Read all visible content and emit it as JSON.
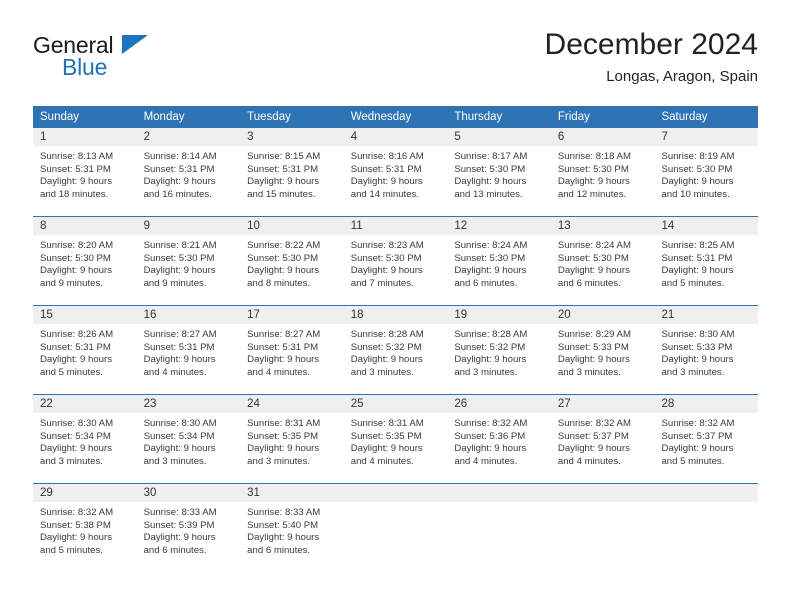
{
  "brand": {
    "name_top": "General",
    "name_bottom": "Blue"
  },
  "header": {
    "month_title": "December 2024",
    "location": "Longas, Aragon, Spain"
  },
  "colors": {
    "header_blue": "#2e74b5",
    "logo_blue": "#1e73be",
    "daynum_band": "#efefef",
    "row_divider": "#2e74b5",
    "page_background": "#ffffff"
  },
  "calendar": {
    "day_headers": [
      "Sunday",
      "Monday",
      "Tuesday",
      "Wednesday",
      "Thursday",
      "Friday",
      "Saturday"
    ],
    "weeks": [
      [
        {
          "day": "1",
          "sunrise": "Sunrise: 8:13 AM",
          "sunset": "Sunset: 5:31 PM",
          "daylight_line1": "Daylight: 9 hours",
          "daylight_line2": "and 18 minutes."
        },
        {
          "day": "2",
          "sunrise": "Sunrise: 8:14 AM",
          "sunset": "Sunset: 5:31 PM",
          "daylight_line1": "Daylight: 9 hours",
          "daylight_line2": "and 16 minutes."
        },
        {
          "day": "3",
          "sunrise": "Sunrise: 8:15 AM",
          "sunset": "Sunset: 5:31 PM",
          "daylight_line1": "Daylight: 9 hours",
          "daylight_line2": "and 15 minutes."
        },
        {
          "day": "4",
          "sunrise": "Sunrise: 8:16 AM",
          "sunset": "Sunset: 5:31 PM",
          "daylight_line1": "Daylight: 9 hours",
          "daylight_line2": "and 14 minutes."
        },
        {
          "day": "5",
          "sunrise": "Sunrise: 8:17 AM",
          "sunset": "Sunset: 5:30 PM",
          "daylight_line1": "Daylight: 9 hours",
          "daylight_line2": "and 13 minutes."
        },
        {
          "day": "6",
          "sunrise": "Sunrise: 8:18 AM",
          "sunset": "Sunset: 5:30 PM",
          "daylight_line1": "Daylight: 9 hours",
          "daylight_line2": "and 12 minutes."
        },
        {
          "day": "7",
          "sunrise": "Sunrise: 8:19 AM",
          "sunset": "Sunset: 5:30 PM",
          "daylight_line1": "Daylight: 9 hours",
          "daylight_line2": "and 10 minutes."
        }
      ],
      [
        {
          "day": "8",
          "sunrise": "Sunrise: 8:20 AM",
          "sunset": "Sunset: 5:30 PM",
          "daylight_line1": "Daylight: 9 hours",
          "daylight_line2": "and 9 minutes."
        },
        {
          "day": "9",
          "sunrise": "Sunrise: 8:21 AM",
          "sunset": "Sunset: 5:30 PM",
          "daylight_line1": "Daylight: 9 hours",
          "daylight_line2": "and 9 minutes."
        },
        {
          "day": "10",
          "sunrise": "Sunrise: 8:22 AM",
          "sunset": "Sunset: 5:30 PM",
          "daylight_line1": "Daylight: 9 hours",
          "daylight_line2": "and 8 minutes."
        },
        {
          "day": "11",
          "sunrise": "Sunrise: 8:23 AM",
          "sunset": "Sunset: 5:30 PM",
          "daylight_line1": "Daylight: 9 hours",
          "daylight_line2": "and 7 minutes."
        },
        {
          "day": "12",
          "sunrise": "Sunrise: 8:24 AM",
          "sunset": "Sunset: 5:30 PM",
          "daylight_line1": "Daylight: 9 hours",
          "daylight_line2": "and 6 minutes."
        },
        {
          "day": "13",
          "sunrise": "Sunrise: 8:24 AM",
          "sunset": "Sunset: 5:30 PM",
          "daylight_line1": "Daylight: 9 hours",
          "daylight_line2": "and 6 minutes."
        },
        {
          "day": "14",
          "sunrise": "Sunrise: 8:25 AM",
          "sunset": "Sunset: 5:31 PM",
          "daylight_line1": "Daylight: 9 hours",
          "daylight_line2": "and 5 minutes."
        }
      ],
      [
        {
          "day": "15",
          "sunrise": "Sunrise: 8:26 AM",
          "sunset": "Sunset: 5:31 PM",
          "daylight_line1": "Daylight: 9 hours",
          "daylight_line2": "and 5 minutes."
        },
        {
          "day": "16",
          "sunrise": "Sunrise: 8:27 AM",
          "sunset": "Sunset: 5:31 PM",
          "daylight_line1": "Daylight: 9 hours",
          "daylight_line2": "and 4 minutes."
        },
        {
          "day": "17",
          "sunrise": "Sunrise: 8:27 AM",
          "sunset": "Sunset: 5:31 PM",
          "daylight_line1": "Daylight: 9 hours",
          "daylight_line2": "and 4 minutes."
        },
        {
          "day": "18",
          "sunrise": "Sunrise: 8:28 AM",
          "sunset": "Sunset: 5:32 PM",
          "daylight_line1": "Daylight: 9 hours",
          "daylight_line2": "and 3 minutes."
        },
        {
          "day": "19",
          "sunrise": "Sunrise: 8:28 AM",
          "sunset": "Sunset: 5:32 PM",
          "daylight_line1": "Daylight: 9 hours",
          "daylight_line2": "and 3 minutes."
        },
        {
          "day": "20",
          "sunrise": "Sunrise: 8:29 AM",
          "sunset": "Sunset: 5:33 PM",
          "daylight_line1": "Daylight: 9 hours",
          "daylight_line2": "and 3 minutes."
        },
        {
          "day": "21",
          "sunrise": "Sunrise: 8:30 AM",
          "sunset": "Sunset: 5:33 PM",
          "daylight_line1": "Daylight: 9 hours",
          "daylight_line2": "and 3 minutes."
        }
      ],
      [
        {
          "day": "22",
          "sunrise": "Sunrise: 8:30 AM",
          "sunset": "Sunset: 5:34 PM",
          "daylight_line1": "Daylight: 9 hours",
          "daylight_line2": "and 3 minutes."
        },
        {
          "day": "23",
          "sunrise": "Sunrise: 8:30 AM",
          "sunset": "Sunset: 5:34 PM",
          "daylight_line1": "Daylight: 9 hours",
          "daylight_line2": "and 3 minutes."
        },
        {
          "day": "24",
          "sunrise": "Sunrise: 8:31 AM",
          "sunset": "Sunset: 5:35 PM",
          "daylight_line1": "Daylight: 9 hours",
          "daylight_line2": "and 3 minutes."
        },
        {
          "day": "25",
          "sunrise": "Sunrise: 8:31 AM",
          "sunset": "Sunset: 5:35 PM",
          "daylight_line1": "Daylight: 9 hours",
          "daylight_line2": "and 4 minutes."
        },
        {
          "day": "26",
          "sunrise": "Sunrise: 8:32 AM",
          "sunset": "Sunset: 5:36 PM",
          "daylight_line1": "Daylight: 9 hours",
          "daylight_line2": "and 4 minutes."
        },
        {
          "day": "27",
          "sunrise": "Sunrise: 8:32 AM",
          "sunset": "Sunset: 5:37 PM",
          "daylight_line1": "Daylight: 9 hours",
          "daylight_line2": "and 4 minutes."
        },
        {
          "day": "28",
          "sunrise": "Sunrise: 8:32 AM",
          "sunset": "Sunset: 5:37 PM",
          "daylight_line1": "Daylight: 9 hours",
          "daylight_line2": "and 5 minutes."
        }
      ],
      [
        {
          "day": "29",
          "sunrise": "Sunrise: 8:32 AM",
          "sunset": "Sunset: 5:38 PM",
          "daylight_line1": "Daylight: 9 hours",
          "daylight_line2": "and 5 minutes."
        },
        {
          "day": "30",
          "sunrise": "Sunrise: 8:33 AM",
          "sunset": "Sunset: 5:39 PM",
          "daylight_line1": "Daylight: 9 hours",
          "daylight_line2": "and 6 minutes."
        },
        {
          "day": "31",
          "sunrise": "Sunrise: 8:33 AM",
          "sunset": "Sunset: 5:40 PM",
          "daylight_line1": "Daylight: 9 hours",
          "daylight_line2": "and 6 minutes."
        },
        {
          "day": "",
          "sunrise": "",
          "sunset": "",
          "daylight_line1": "",
          "daylight_line2": ""
        },
        {
          "day": "",
          "sunrise": "",
          "sunset": "",
          "daylight_line1": "",
          "daylight_line2": ""
        },
        {
          "day": "",
          "sunrise": "",
          "sunset": "",
          "daylight_line1": "",
          "daylight_line2": ""
        },
        {
          "day": "",
          "sunrise": "",
          "sunset": "",
          "daylight_line1": "",
          "daylight_line2": ""
        }
      ]
    ]
  }
}
